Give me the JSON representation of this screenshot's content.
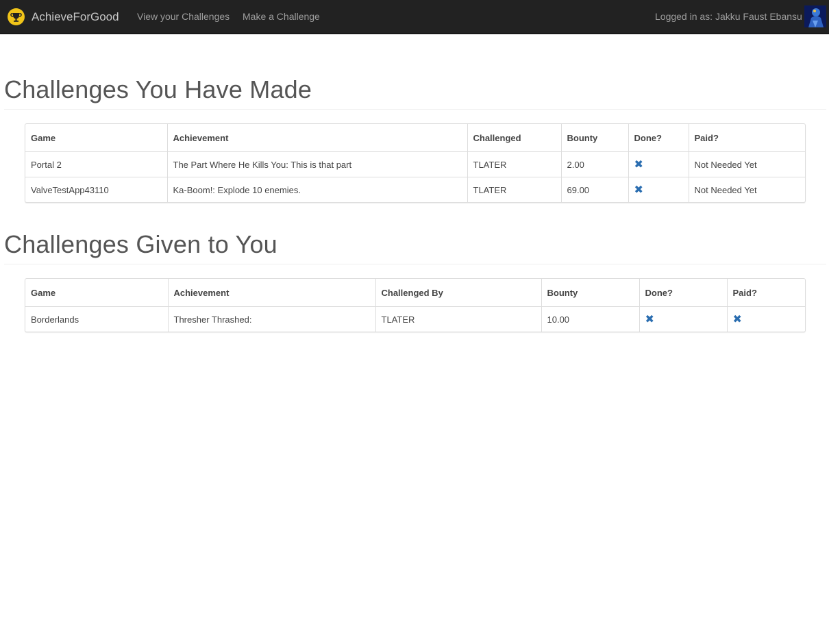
{
  "header": {
    "brand": "AchieveForGood",
    "nav": {
      "view": "View your Challenges",
      "make": "Make a Challenge"
    },
    "logged_in": "Logged in as: Jakku Faust Ebansu"
  },
  "made": {
    "title": "Challenges You Have Made",
    "columns": [
      "Game",
      "Achievement",
      "Challenged",
      "Bounty",
      "Done?",
      "Paid?"
    ],
    "rows": [
      {
        "game": "Portal 2",
        "achievement": "The Part Where He Kills You: This is that part",
        "challenged": "TLATER",
        "bounty": "2.00",
        "done": "✖",
        "paid": "Not Needed Yet"
      },
      {
        "game": "ValveTestApp43110",
        "achievement": "Ka-Boom!: Explode 10 enemies.",
        "challenged": "TLATER",
        "bounty": "69.00",
        "done": "✖",
        "paid": "Not Needed Yet"
      }
    ]
  },
  "given": {
    "title": "Challenges Given to You",
    "columns": [
      "Game",
      "Achievement",
      "Challenged By",
      "Bounty",
      "Done?",
      "Paid?"
    ],
    "rows": [
      {
        "game": "Borderlands",
        "achievement": "Thresher Thrashed:",
        "challenged_by": "TLATER",
        "bounty": "10.00",
        "done": "✖",
        "paid": "✖"
      }
    ]
  },
  "icons": {
    "brand": "trophy-icon",
    "status_no": "remove-icon",
    "avatar": "user-avatar"
  },
  "colors": {
    "navbar": "#222222",
    "brand_logo": "#f0c419",
    "icon_blue": "#2a6db0"
  }
}
